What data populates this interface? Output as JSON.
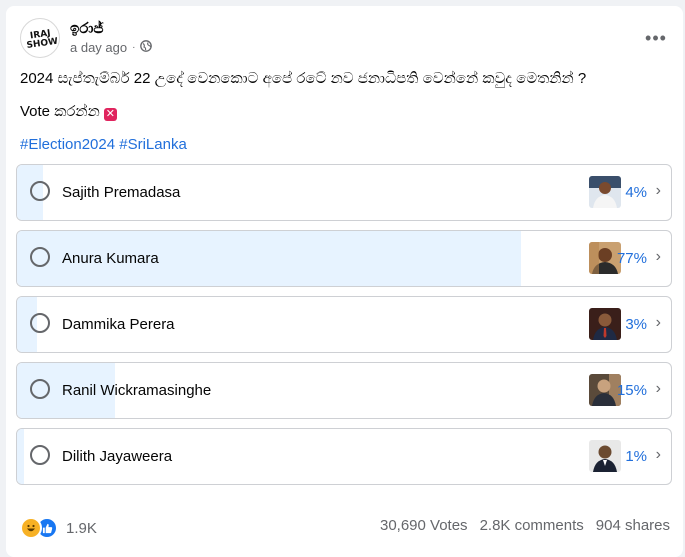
{
  "post": {
    "author": "ඉරාජ්",
    "time": "a day ago",
    "privacy_icon": "globe-icon",
    "avatar_text": "IRAJ SHOW",
    "text_line1": "2024 සැප්තැම්බර් 22 උදේ වෙනකොට අපේ රටේ නව ජනාධිපති වෙන්නේ කවුද මෙතනින් ?",
    "text_line2": "Vote කරන්න",
    "hashtag1": "#Election2024",
    "hashtag2": "#SriLanka"
  },
  "poll": {
    "options": [
      {
        "label": "Sajith Premadasa",
        "percent_text": "4%",
        "percent": 4
      },
      {
        "label": "Anura Kumara",
        "percent_text": "77%",
        "percent": 77
      },
      {
        "label": "Dammika Perera",
        "percent_text": "3%",
        "percent": 3
      },
      {
        "label": "Ranil Wickramasinghe",
        "percent_text": "15%",
        "percent": 15
      },
      {
        "label": "Dilith Jayaweera",
        "percent_text": "1%",
        "percent": 1
      }
    ]
  },
  "footer": {
    "reaction_count": "1.9K",
    "votes": "30,690 Votes",
    "comments": "2.8K comments",
    "shares": "904 shares"
  },
  "colors": {
    "accent": "#216fdb",
    "fill": "#e7f3ff",
    "like": "#1877f2",
    "haha": "#f7b125"
  }
}
